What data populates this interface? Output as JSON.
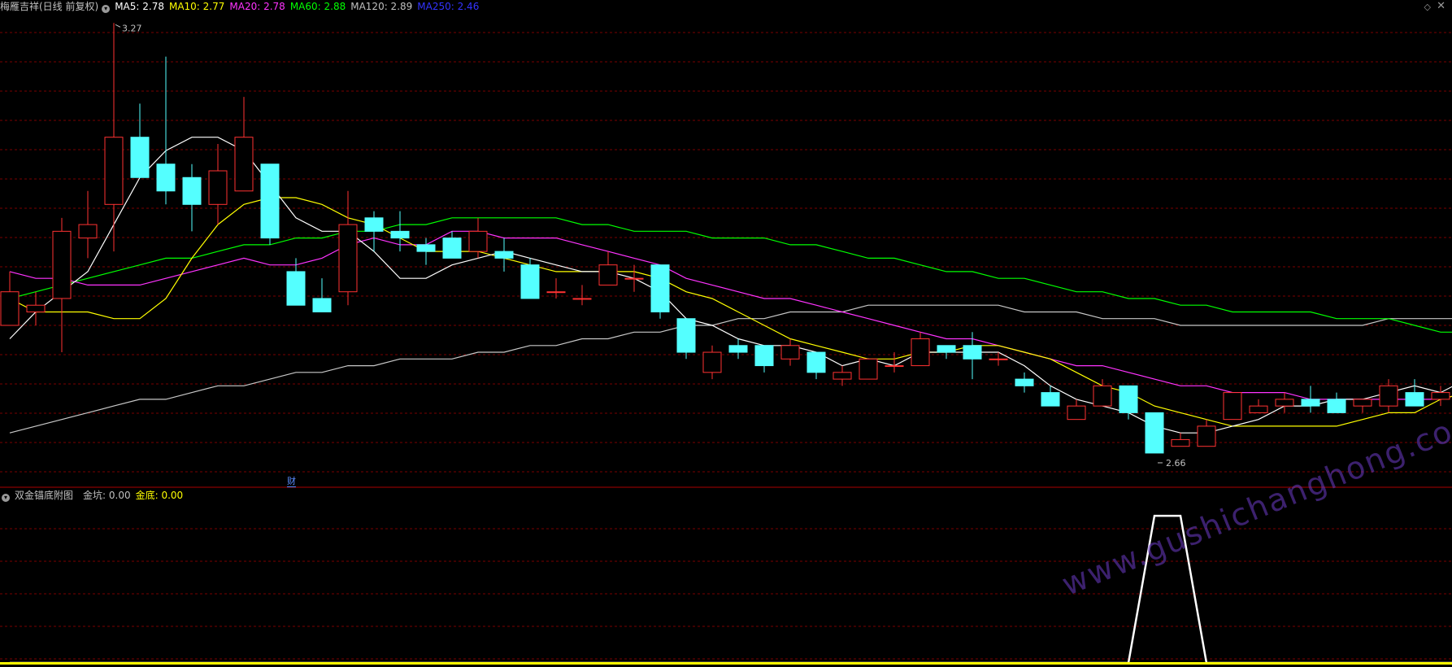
{
  "header": {
    "title": "梅雁吉祥(日线 前复权)",
    "indicators": [
      {
        "label": "MA5: 2.78",
        "color": "#ffffff"
      },
      {
        "label": "MA10: 2.77",
        "color": "#ffff00"
      },
      {
        "label": "MA20: 2.78",
        "color": "#ff33ff"
      },
      {
        "label": "MA60: 2.88",
        "color": "#00ff00"
      },
      {
        "label": "MA120: 2.89",
        "color": "#c0c0c0"
      },
      {
        "label": "MA250: 2.46",
        "color": "#3333ff"
      }
    ]
  },
  "sub_header": {
    "title": "双金锚底附图",
    "fields": [
      {
        "label": "金坑: 0.00",
        "color": "#c0c0c0"
      },
      {
        "label": "金底: 0.00",
        "color": "#ffff00"
      }
    ]
  },
  "annotations": {
    "high_label": "3.27",
    "low_label": "2.66",
    "finance_badge": "财"
  },
  "watermark": "www.gushichanghong.com",
  "colors": {
    "up": "#ff3232",
    "down": "#54ffff",
    "ma5": "#ffffff",
    "ma10": "#ffff00",
    "ma20": "#ff33ff",
    "ma60": "#00ff00",
    "ma120": "#c8c8c8",
    "grid": "#7a0000",
    "separator": "#aa0000",
    "sub_line": "#ffffff",
    "sub_base": "#ffff00"
  },
  "chart_data": {
    "type": "candlestick",
    "ylim": [
      2.59,
      3.28
    ],
    "candles": [
      [
        2.82,
        2.87,
        2.9,
        2.82
      ],
      [
        2.84,
        2.85,
        2.87,
        2.82
      ],
      [
        2.86,
        2.96,
        2.98,
        2.78
      ],
      [
        2.95,
        2.97,
        3.02,
        2.92
      ],
      [
        3.0,
        3.1,
        3.27,
        2.93
      ],
      [
        3.1,
        3.04,
        3.15,
        3.04
      ],
      [
        3.06,
        3.02,
        3.22,
        3.0
      ],
      [
        3.04,
        3.0,
        3.06,
        2.96
      ],
      [
        3.0,
        3.05,
        3.09,
        2.97
      ],
      [
        3.02,
        3.1,
        3.16,
        3.02
      ],
      [
        3.06,
        2.95,
        3.06,
        2.94
      ],
      [
        2.9,
        2.85,
        2.92,
        2.85
      ],
      [
        2.86,
        2.84,
        2.89,
        2.84
      ],
      [
        2.87,
        2.97,
        3.02,
        2.85
      ],
      [
        2.98,
        2.96,
        2.99,
        2.93
      ],
      [
        2.96,
        2.95,
        2.99,
        2.93
      ],
      [
        2.94,
        2.93,
        2.95,
        2.91
      ],
      [
        2.95,
        2.92,
        2.96,
        2.92
      ],
      [
        2.93,
        2.96,
        2.98,
        2.92
      ],
      [
        2.93,
        2.92,
        2.95,
        2.9
      ],
      [
        2.91,
        2.86,
        2.92,
        2.86
      ],
      [
        2.87,
        2.87,
        2.89,
        2.86
      ],
      [
        2.86,
        2.86,
        2.88,
        2.85
      ],
      [
        2.88,
        2.91,
        2.93,
        2.88
      ],
      [
        2.89,
        2.89,
        2.91,
        2.87
      ],
      [
        2.91,
        2.84,
        2.91,
        2.83
      ],
      [
        2.83,
        2.78,
        2.83,
        2.77
      ],
      [
        2.75,
        2.78,
        2.79,
        2.74
      ],
      [
        2.79,
        2.78,
        2.8,
        2.77
      ],
      [
        2.79,
        2.76,
        2.79,
        2.75
      ],
      [
        2.77,
        2.79,
        2.8,
        2.76
      ],
      [
        2.78,
        2.75,
        2.78,
        2.74
      ],
      [
        2.74,
        2.75,
        2.76,
        2.73
      ],
      [
        2.74,
        2.77,
        2.77,
        2.74
      ],
      [
        2.76,
        2.76,
        2.78,
        2.75
      ],
      [
        2.76,
        2.8,
        2.81,
        2.76
      ],
      [
        2.79,
        2.78,
        2.79,
        2.77
      ],
      [
        2.79,
        2.77,
        2.81,
        2.74
      ],
      [
        2.77,
        2.77,
        2.78,
        2.76
      ],
      [
        2.74,
        2.73,
        2.75,
        2.72
      ],
      [
        2.72,
        2.7,
        2.73,
        2.7
      ],
      [
        2.68,
        2.7,
        2.71,
        2.68
      ],
      [
        2.7,
        2.73,
        2.74,
        2.7
      ],
      [
        2.73,
        2.69,
        2.73,
        2.68
      ],
      [
        2.69,
        2.63,
        2.69,
        2.63
      ],
      [
        2.64,
        2.65,
        2.66,
        2.64
      ],
      [
        2.64,
        2.67,
        2.68,
        2.66
      ],
      [
        2.68,
        2.72,
        2.72,
        2.68
      ],
      [
        2.69,
        2.7,
        2.71,
        2.69
      ],
      [
        2.7,
        2.71,
        2.72,
        2.69
      ],
      [
        2.71,
        2.7,
        2.73,
        2.69
      ],
      [
        2.71,
        2.69,
        2.72,
        2.69
      ],
      [
        2.7,
        2.71,
        2.71,
        2.69
      ],
      [
        2.7,
        2.73,
        2.74,
        2.69
      ],
      [
        2.72,
        2.7,
        2.74,
        2.7
      ],
      [
        2.71,
        2.72,
        2.73,
        2.7
      ],
      [
        2.69,
        2.74,
        2.78,
        2.69
      ]
    ],
    "ma5": [
      2.8,
      2.84,
      2.87,
      2.9,
      2.97,
      3.04,
      3.08,
      3.1,
      3.1,
      3.08,
      3.03,
      2.98,
      2.96,
      2.96,
      2.93,
      2.89,
      2.89,
      2.91,
      2.92,
      2.93,
      2.92,
      2.91,
      2.9,
      2.9,
      2.89,
      2.87,
      2.83,
      2.82,
      2.8,
      2.79,
      2.79,
      2.78,
      2.76,
      2.77,
      2.76,
      2.78,
      2.78,
      2.78,
      2.78,
      2.76,
      2.73,
      2.71,
      2.7,
      2.69,
      2.67,
      2.66,
      2.66,
      2.67,
      2.68,
      2.7,
      2.7,
      2.71,
      2.71,
      2.72,
      2.73,
      2.72,
      2.74
    ],
    "ma10": [
      2.86,
      2.84,
      2.84,
      2.84,
      2.83,
      2.83,
      2.86,
      2.92,
      2.97,
      3.0,
      3.01,
      3.01,
      3.0,
      2.98,
      2.97,
      2.95,
      2.93,
      2.93,
      2.93,
      2.92,
      2.91,
      2.9,
      2.9,
      2.9,
      2.9,
      2.89,
      2.87,
      2.86,
      2.84,
      2.82,
      2.8,
      2.79,
      2.78,
      2.77,
      2.77,
      2.78,
      2.78,
      2.79,
      2.79,
      2.78,
      2.77,
      2.75,
      2.73,
      2.72,
      2.7,
      2.69,
      2.68,
      2.67,
      2.67,
      2.67,
      2.67,
      2.67,
      2.68,
      2.69,
      2.69,
      2.71,
      2.72
    ],
    "ma20": [
      2.9,
      2.89,
      2.89,
      2.88,
      2.88,
      2.88,
      2.89,
      2.9,
      2.91,
      2.92,
      2.91,
      2.91,
      2.92,
      2.94,
      2.95,
      2.94,
      2.94,
      2.96,
      2.96,
      2.95,
      2.95,
      2.95,
      2.94,
      2.93,
      2.92,
      2.91,
      2.89,
      2.88,
      2.87,
      2.86,
      2.86,
      2.85,
      2.84,
      2.83,
      2.82,
      2.81,
      2.8,
      2.8,
      2.79,
      2.78,
      2.77,
      2.76,
      2.76,
      2.75,
      2.74,
      2.73,
      2.73,
      2.72,
      2.72,
      2.72,
      2.71,
      2.71,
      2.71,
      2.71,
      2.71,
      2.71,
      2.72
    ],
    "ma60": [
      2.86,
      2.87,
      2.88,
      2.89,
      2.9,
      2.91,
      2.92,
      2.92,
      2.93,
      2.94,
      2.94,
      2.95,
      2.95,
      2.96,
      2.96,
      2.97,
      2.97,
      2.98,
      2.98,
      2.98,
      2.98,
      2.98,
      2.97,
      2.97,
      2.96,
      2.96,
      2.96,
      2.95,
      2.95,
      2.95,
      2.94,
      2.94,
      2.93,
      2.92,
      2.92,
      2.91,
      2.9,
      2.9,
      2.89,
      2.89,
      2.88,
      2.87,
      2.87,
      2.86,
      2.86,
      2.85,
      2.85,
      2.84,
      2.84,
      2.84,
      2.84,
      2.83,
      2.83,
      2.83,
      2.82,
      2.81,
      2.81
    ],
    "ma120": [
      2.66,
      2.67,
      2.68,
      2.69,
      2.7,
      2.71,
      2.71,
      2.72,
      2.73,
      2.73,
      2.74,
      2.75,
      2.75,
      2.76,
      2.76,
      2.77,
      2.77,
      2.77,
      2.78,
      2.78,
      2.79,
      2.79,
      2.8,
      2.8,
      2.81,
      2.81,
      2.82,
      2.82,
      2.83,
      2.83,
      2.84,
      2.84,
      2.84,
      2.85,
      2.85,
      2.85,
      2.85,
      2.85,
      2.85,
      2.84,
      2.84,
      2.84,
      2.83,
      2.83,
      2.83,
      2.82,
      2.82,
      2.82,
      2.82,
      2.82,
      2.82,
      2.82,
      2.82,
      2.83,
      2.83,
      2.83,
      2.83
    ],
    "sub_signal": {
      "ylim": [
        0,
        1.1
      ],
      "values": [
        0,
        0,
        0,
        0,
        0,
        0,
        0,
        0,
        0,
        0,
        0,
        0,
        0,
        0,
        0,
        0,
        0,
        0,
        0,
        0,
        0,
        0,
        0,
        0,
        0,
        0,
        0,
        0,
        0,
        0,
        0,
        0,
        0,
        0,
        0,
        0,
        0,
        0,
        0,
        0,
        0,
        0,
        0,
        0,
        1,
        1,
        0,
        0,
        0,
        0,
        0,
        0,
        0,
        0,
        0,
        0,
        0
      ]
    }
  }
}
